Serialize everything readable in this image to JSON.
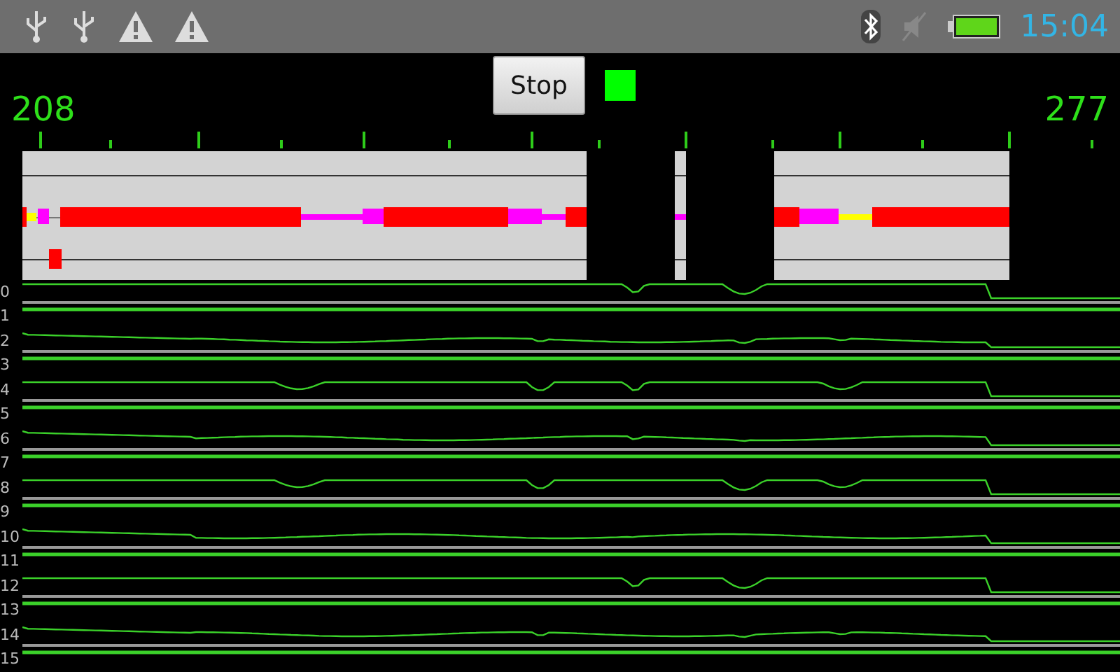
{
  "status_bar": {
    "time": "15:04"
  },
  "header": {
    "left_value": "208",
    "right_value": "277",
    "button": "Stop",
    "indicator": {
      "on": true
    }
  },
  "channels": [
    {
      "label": "0"
    },
    {
      "label": "1"
    },
    {
      "label": "2"
    },
    {
      "label": "3"
    },
    {
      "label": "4"
    },
    {
      "label": "5"
    },
    {
      "label": "6"
    },
    {
      "label": "7"
    },
    {
      "label": "8"
    },
    {
      "label": "9"
    },
    {
      "label": "10"
    },
    {
      "label": "11"
    },
    {
      "label": "12"
    },
    {
      "label": "13"
    },
    {
      "label": "14"
    },
    {
      "label": "15"
    }
  ]
}
